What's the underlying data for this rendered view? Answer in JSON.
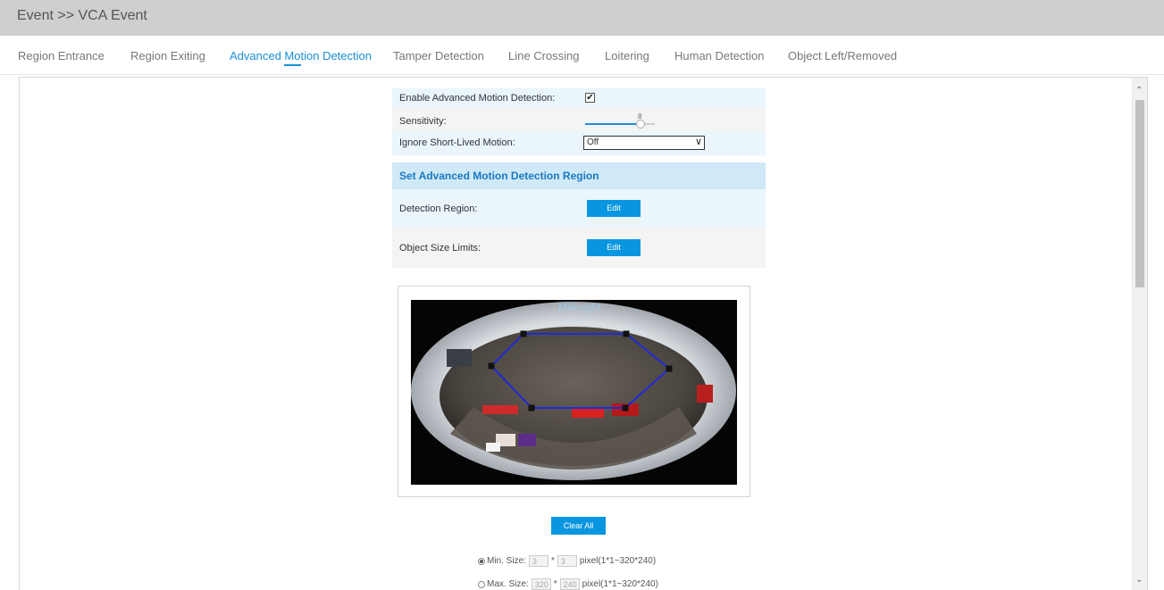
{
  "header": {
    "title": "Event >> VCA Event"
  },
  "tabs": [
    {
      "label": "Region Entrance"
    },
    {
      "label": "Region Exiting"
    },
    {
      "label": "Advanced Motion Detection"
    },
    {
      "label": "Tamper Detection"
    },
    {
      "label": "Line Crossing"
    },
    {
      "label": "Loitering"
    },
    {
      "label": "Human Detection"
    },
    {
      "label": "Object Left/Removed"
    }
  ],
  "active_tab": "Advanced Motion Detection",
  "form": {
    "enable_label": "Enable Advanced Motion Detection:",
    "enable_checked": true,
    "check_glyph": "✔",
    "sensitivity_label": "Sensitivity:",
    "sensitivity_value": "8",
    "sensitivity_max": 10,
    "ignore_label": "Ignore Short-Lived Motion:",
    "ignore_value": "Off",
    "section_title": "Set Advanced Motion Detection Region",
    "detection_region_label": "Detection Region:",
    "object_size_label": "Object Size Limits:",
    "edit_label": "Edit"
  },
  "preview": {
    "overlay_text": "Milesight"
  },
  "clear_all_label": "Clear All",
  "min_size": {
    "label": "Min. Size:",
    "w": "3",
    "sep": "*",
    "h": "3",
    "range": "pixel(1*1~320*240)",
    "selected": true
  },
  "max_size": {
    "label": "Max. Size:",
    "w": "320",
    "sep": "*",
    "h": "240",
    "range": "pixel(1*1~320*240)",
    "selected": false
  },
  "icons": {
    "scroll_up": "scroll-up-icon",
    "scroll_down": "scroll-down-icon",
    "dropdown": "chevron-down-icon"
  },
  "colors": {
    "accent": "#1a8fd8",
    "button": "#0996e0",
    "region_polygon": "#1f2bd6"
  }
}
